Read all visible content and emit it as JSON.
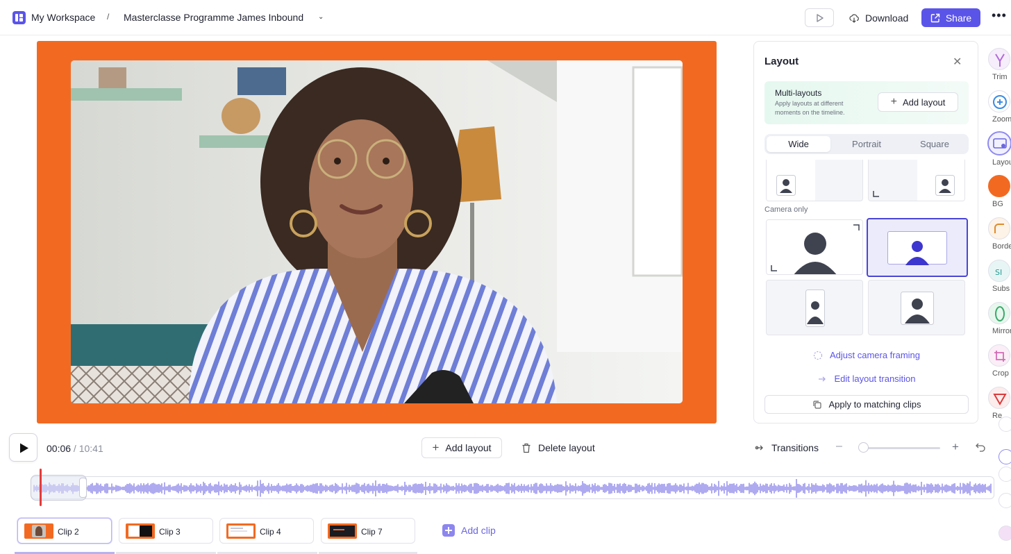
{
  "topbar": {
    "workspace": "My Workspace",
    "separator": "/",
    "project": "Masterclasse Programme James Inbound",
    "download": "Download",
    "share": "Share",
    "more": "•••"
  },
  "canvas": {
    "background_color": "#f26a22"
  },
  "layout_panel": {
    "title": "Layout",
    "multi_title": "Multi-layouts",
    "multi_desc": "Apply layouts at different moments on the timeline.",
    "add_layout": "Add layout",
    "tabs": [
      "Wide",
      "Portrait",
      "Square"
    ],
    "active_tab": "Wide",
    "camera_only_label": "Camera only",
    "adjust_framing": "Adjust camera framing",
    "edit_transition": "Edit layout transition",
    "apply_matching": "Apply to matching clips"
  },
  "tools": [
    {
      "label": "Trim",
      "icon": "trim-icon"
    },
    {
      "label": "Zoom",
      "icon": "zoom-icon"
    },
    {
      "label": "Layou",
      "icon": "layout-icon"
    },
    {
      "label": "BG",
      "icon": "background-color-icon",
      "color": "#f26a22"
    },
    {
      "label": "Borde",
      "icon": "border-icon"
    },
    {
      "label": "Subs",
      "icon": "subtitles-icon"
    },
    {
      "label": "Mirror",
      "icon": "mirror-icon"
    },
    {
      "label": "Crop",
      "icon": "crop-icon"
    },
    {
      "label": "Re",
      "icon": "record-icon"
    }
  ],
  "playback": {
    "current_time": "00:06",
    "separator": " / ",
    "duration": "10:41",
    "add_layout": "Add layout",
    "delete_layout": "Delete layout",
    "transitions": "Transitions",
    "zoom_minus": "–",
    "zoom_plus": "+"
  },
  "clips": [
    {
      "label": "Clip 2",
      "active": true
    },
    {
      "label": "Clip 3",
      "active": false
    },
    {
      "label": "Clip 4",
      "active": false
    },
    {
      "label": "Clip 7",
      "active": false
    }
  ],
  "add_clip": "Add clip",
  "colors": {
    "accent": "#5b54e8",
    "brand_orange": "#f26a22",
    "playhead": "#e33b3b",
    "waveform": "#7a73e6"
  }
}
